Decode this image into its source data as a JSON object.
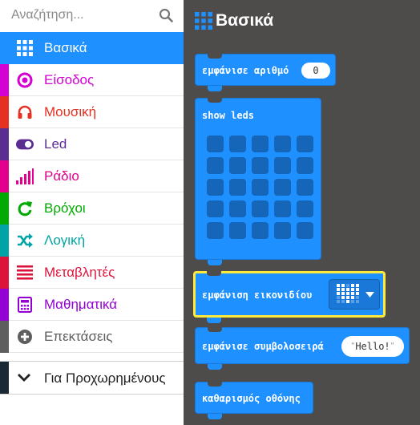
{
  "search": {
    "placeholder": "Αναζήτηση..."
  },
  "categories": [
    {
      "label": "Βασικά",
      "color": "#1e90ff",
      "icon": "grid-icon",
      "selected": true
    },
    {
      "label": "Είσοδος",
      "color": "#d400d4",
      "icon": "target-icon"
    },
    {
      "label": "Μουσική",
      "color": "#e63022",
      "icon": "headphones-icon"
    },
    {
      "label": "Led",
      "color": "#5c2d91",
      "icon": "toggle-icon"
    },
    {
      "label": "Ράδιο",
      "color": "#e3008c",
      "icon": "signal-icon"
    },
    {
      "label": "Βρόχοι",
      "color": "#00aa00",
      "icon": "loop-arrow-icon"
    },
    {
      "label": "Λογική",
      "color": "#00a4a6",
      "icon": "shuffle-icon"
    },
    {
      "label": "Μεταβλητές",
      "color": "#dc143c",
      "icon": "list-icon"
    },
    {
      "label": "Μαθηματικά",
      "color": "#9400d3",
      "icon": "calculator-icon"
    },
    {
      "label": "Επεκτάσεις",
      "color": "#5e5e5e",
      "icon": "plus-circle-icon"
    }
  ],
  "advanced": {
    "label": "Για Προχωρημένους",
    "icon": "chevron-down-icon"
  },
  "flyout": {
    "title": "Βασικά",
    "blocks": {
      "show_number": {
        "label": "εμφάνισε αριθμό",
        "value": "0"
      },
      "show_leds": {
        "label": "show leds"
      },
      "show_icon": {
        "label": "εμφάνιση εικονιδίου",
        "icon": "heart-icon"
      },
      "show_string": {
        "label": "εμφάνισε συμβολοσειρά",
        "value": "Hello!"
      },
      "clear_screen": {
        "label": "καθαρισμός οθόνης"
      }
    }
  }
}
